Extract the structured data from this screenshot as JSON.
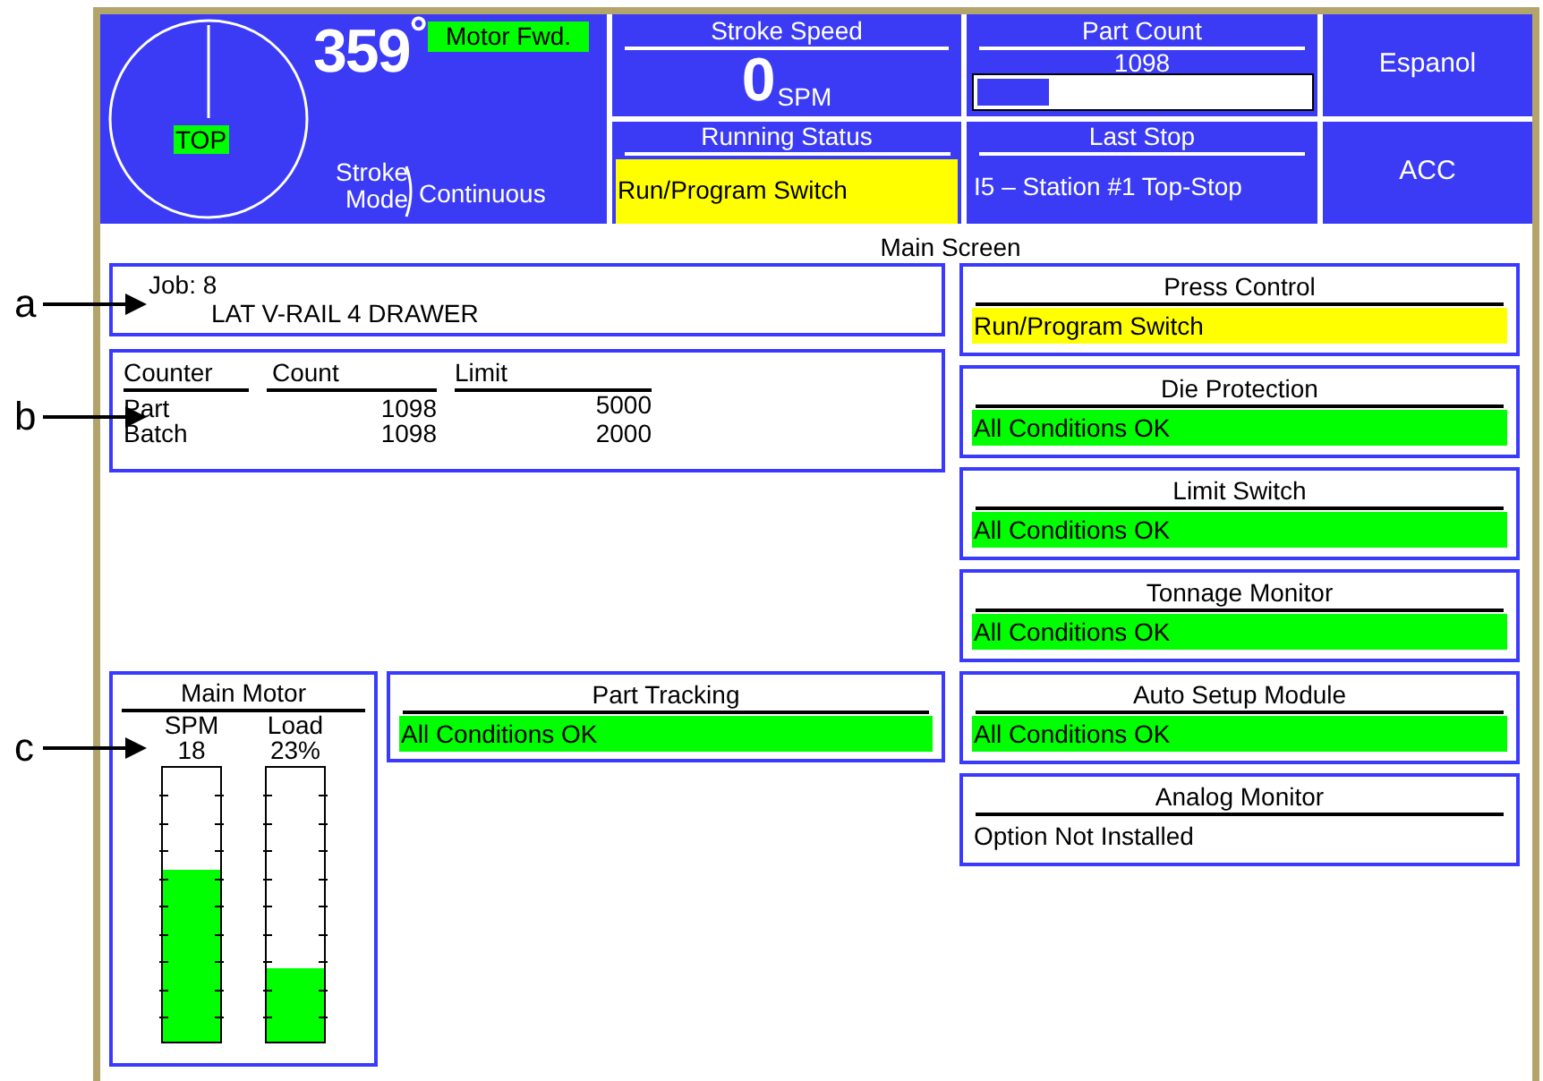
{
  "header": {
    "angle": "359$^{°}$",
    "motor": "Motor Fwd.",
    "top_label": "TOP",
    "stroke_mode_label": "Stroke Mode",
    "stroke_mode": "Continuous",
    "stroke_speed": {
      "title": "Stroke Speed",
      "value": "0",
      "unit": "SPM"
    },
    "part_count": {
      "title": "Part Count",
      "value": "1098",
      "level": 0.22
    },
    "running_status": {
      "title": "Running Status",
      "value": "Run/Program Switch",
      "kind": "warning"
    },
    "last_stop": {
      "title": "Last Stop",
      "value": "I5 – Station #1 Top-Stop"
    },
    "buttons": [
      "Espanol",
      "ACC"
    ]
  },
  "screen_title": "Main Screen",
  "job": {
    "label": "Job: 8",
    "name": "LAT V-RAIL 4 DRAWER"
  },
  "counters": {
    "columns": [
      "Counter",
      "Count",
      "Limit"
    ],
    "rows": [
      {
        "name": "Part",
        "count": "1098",
        "limit": "5000"
      },
      {
        "name": "Batch",
        "count": "1098",
        "limit": "2000"
      }
    ]
  },
  "main_motor": {
    "title": "Main Motor",
    "meters": [
      {
        "label": "SPM",
        "reading": "18",
        "level": 0.63
      },
      {
        "label": "Load",
        "reading": "23%",
        "level": 0.27
      }
    ]
  },
  "part_tracking": {
    "title": "Part Tracking",
    "status": "All Conditions OK",
    "kind": "ok"
  },
  "modules": [
    {
      "title": "Press Control",
      "status": "Run/Program Switch",
      "kind": "warning"
    },
    {
      "title": "Die Protection",
      "status": "All Conditions OK",
      "kind": "ok"
    },
    {
      "title": "Limit Switch",
      "status": "All Conditions OK",
      "kind": "ok"
    },
    {
      "title": "Tonnage Monitor",
      "status": "All Conditions OK",
      "kind": "ok"
    },
    {
      "title": "Auto Setup Module",
      "status": "All Conditions OK",
      "kind": "ok"
    },
    {
      "title": "Analog Monitor",
      "status": "Option Not Installed",
      "kind": "plain"
    }
  ],
  "callouts": [
    "a",
    "b",
    "c"
  ]
}
